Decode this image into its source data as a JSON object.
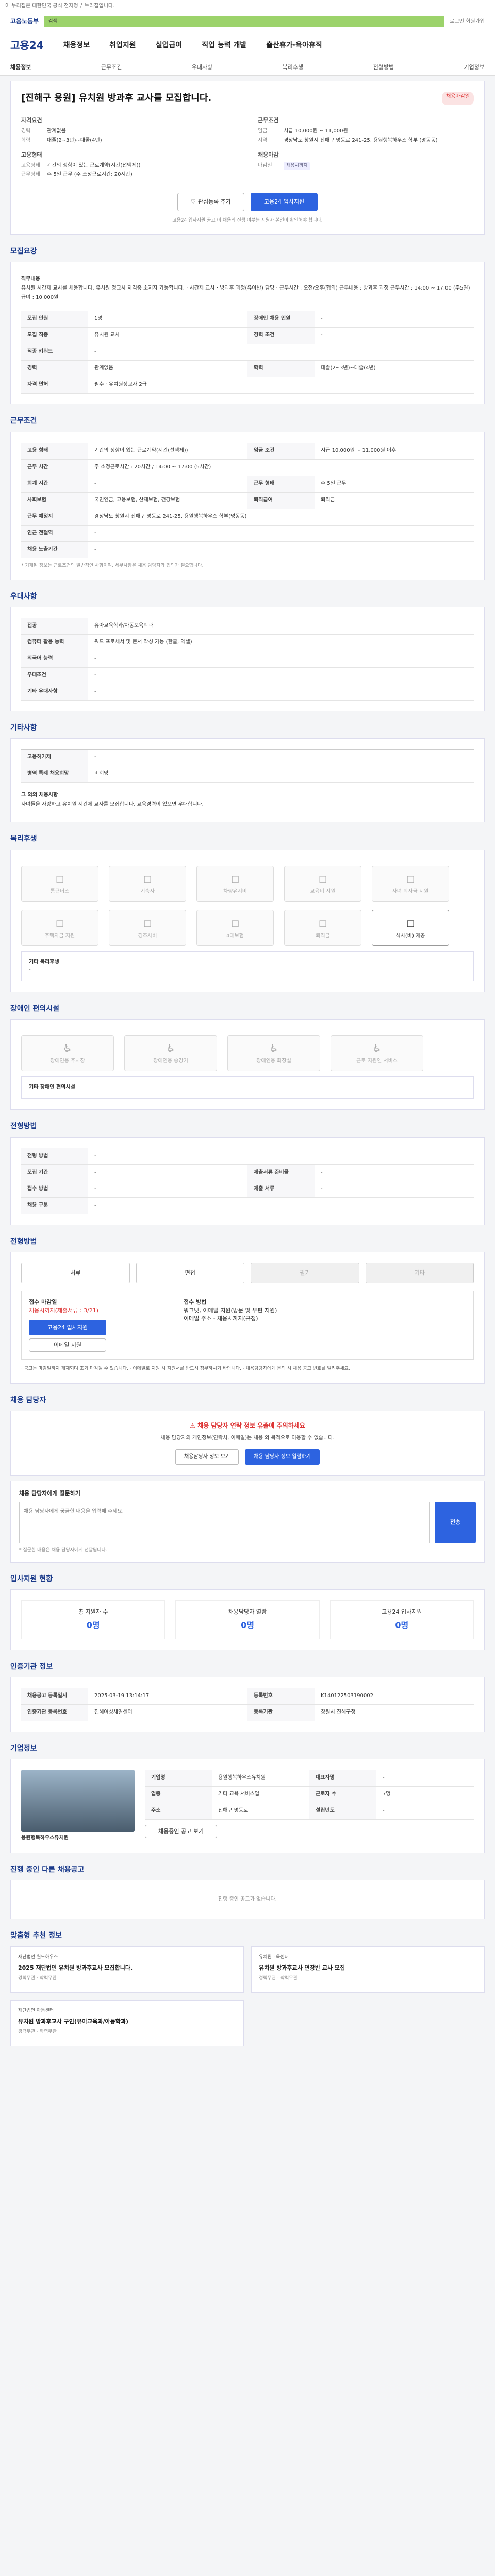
{
  "topnote": "이 누리집은 대한민국 공식 전자정부 누리집입니다.",
  "header": {
    "gov_logo": "고용노동부",
    "search_placeholder": "검색",
    "util": "로그인  회원가입",
    "brand": "고용24",
    "menu": [
      "채용정보",
      "취업지원",
      "실업급여",
      "직업 능력 개발",
      "출산휴가·육아휴직"
    ],
    "crumb_left": "채용정보",
    "crumb_tabs": [
      "근무조건",
      "우대사항",
      "복리후생",
      "전형방법",
      "기업정보"
    ]
  },
  "summary": {
    "title": "[진해구 용원] 유치원 방과후 교사를 모집합니다.",
    "badge": "채용마감일",
    "job_h": "자격요건",
    "job": [
      {
        "k": "경력",
        "v": "관계없음"
      },
      {
        "k": "학력",
        "v": "대졸(2~3년)~대졸(4년)"
      }
    ],
    "cond_h": "근무조건",
    "cond": [
      {
        "k": "임금",
        "v": "시급 10,000원 ~ 11,000원"
      },
      {
        "k": "지역",
        "v": "경상남도 창원시 진해구 명동로 241-25, 용원행복하우스 학부 (명동동)"
      }
    ],
    "form_h": "고용형태",
    "form": [
      {
        "k": "고용형태",
        "v": "기간의 정함이 있는 근로계약(시간(선택제))"
      },
      {
        "k": "근무형태",
        "v": "주 5일 근무 (주 소정근로시간: 20시간)"
      }
    ],
    "apply_h": "채용마감",
    "apply": [
      {
        "k": "마감일",
        "v": "채용시까지"
      }
    ],
    "btn_scrap": "관심등록 추가",
    "btn_apply": "고용24 입사지원",
    "note": "고용24 입사지원 공고 이 채용의 진행 여부는 지원자 본인이 확인해야 합니다."
  },
  "req": {
    "title": "모집요강",
    "role_h": "직무내용",
    "role": "유치원 시간제 교사를 채용합니다. 유치원 정교사 자격증 소지자 가능합니다. · 시간제 교사 · 방과후 과정(유아반) 담당 · 근무시간 : 오전/오후(협의) 근무내용 : 방과후 과정 근무시간 : 14:00 ~ 17:00 (주5일) 급여 : 10,000원",
    "rows": [
      {
        "k": "모집 인원",
        "v": "1명",
        "k2": "장애인 채용 인원",
        "v2": "-"
      },
      {
        "k": "모집 직종",
        "v": "유치원 교사",
        "k2": "경력 조건",
        "v2": "-"
      },
      {
        "k": "직종 키워드",
        "v": "-",
        "k2": "",
        "v2": ""
      },
      {
        "k": "경력",
        "v": "관계없음",
        "k2": "학력",
        "v2": "대졸(2~3년)~대졸(4년)"
      },
      {
        "k": "자격 면허",
        "v": "필수 · 유치원정교사 2급",
        "k2": "",
        "v2": ""
      }
    ]
  },
  "work": {
    "title": "근무조건",
    "rows": [
      {
        "k": "고용 형태",
        "v": "기간의 정함이 있는 근로계약(시간(선택제))",
        "k2": "임금 조건",
        "v2": "시급 10,000원 ~ 11,000원 이후"
      },
      {
        "k": "근무 시간",
        "v": "주 소정근로시간 : 20시간 / 14:00 ~ 17:00 (5시간)",
        "k2": "",
        "v2": ""
      },
      {
        "k": "회계 시간",
        "v": "-",
        "k2": "근무 형태",
        "v2": "주 5일 근무"
      },
      {
        "k": "사회보험",
        "v": "국민연금, 고용보험, 산재보험, 건강보험",
        "k2": "퇴직급여",
        "v2": "퇴직금"
      },
      {
        "k": "근무 예정지",
        "v": "경상남도 창원시 진해구 명동로 241-25, 용원행복하우스 학부(명동동)",
        "k2": "",
        "v2": ""
      },
      {
        "k": "인근 전철역",
        "v": "-",
        "k2": "",
        "v2": ""
      },
      {
        "k": "채용 노출기간",
        "v": "-",
        "k2": "",
        "v2": ""
      }
    ],
    "map_btn": "지도 보기",
    "hint": "* 기재된 정보는 근로조건의 일반적인 사항이며, 세부사항은 채용 담당자와 협의가 필요합니다."
  },
  "pref": {
    "title": "우대사항",
    "rows": [
      {
        "k": "전공",
        "v": "유아교육학과/아동보육학과"
      },
      {
        "k": "컴퓨터 활용 능력",
        "v": "워드 프로세서 및 문서 작성 가능 (한글, 엑셀)"
      },
      {
        "k": "외국어 능력",
        "v": "-"
      },
      {
        "k": "우대조건",
        "v": "-"
      },
      {
        "k": "기타 우대사항",
        "v": "-"
      }
    ]
  },
  "etc": {
    "title": "기타사항",
    "rows": [
      {
        "k": "고용허가제",
        "v": "-"
      },
      {
        "k": "병역 특례 채용희망",
        "v": "비희망"
      }
    ],
    "detail_h": "그 외의 채용사항",
    "detail": "자녀들을 사랑하고 유치원 시간제 교사를 모집합니다. 교육경력이 있으면 우대합니다."
  },
  "welfare": {
    "title": "복리후생",
    "items": [
      "통근버스",
      "기숙사",
      "차량유지비",
      "교육비 지원",
      "자녀 학자금 지원",
      "주택자금 지원",
      "경조사비",
      "4대보험",
      "퇴직금",
      "식사(비) 제공"
    ],
    "active": [
      9
    ],
    "other_h": "기타 복리후생",
    "other": "-"
  },
  "disab": {
    "title": "장애인 편의시설",
    "items": [
      "장애인용 주차장",
      "장애인용 승강기",
      "장애인용 화장실",
      "근로 지원인 서비스"
    ],
    "other": "기타 장애인 편의시설"
  },
  "sel": {
    "title": "전형방법",
    "rows": [
      {
        "k": "전형 방법",
        "v": "-"
      },
      {
        "k": "모집 기간",
        "v": "-",
        "k2": "제출서류 준비물",
        "v2": "-"
      },
      {
        "k": "접수 방법",
        "v": "-",
        "k2": "제출 서류",
        "v2": "-"
      },
      {
        "k": "채용 구분",
        "v": "-",
        "k2": "",
        "v2": ""
      }
    ]
  },
  "howto": {
    "title": "전형방법",
    "tabs": [
      "서류",
      "면접",
      "필기",
      "기타"
    ],
    "left_h": "접수 마감일",
    "left_red": "채용시까지(제출서류 : 3/21)",
    "apply_btn": "고용24 입사지원",
    "extra_btn": "이메일 지원",
    "right_h": "접수 방법",
    "right": "워크넷, 이메일 지원(방문 및 우편 지원)",
    "right2": "이메일 주소 - 채용시까지(규정)",
    "warn": "· 공고는 마감일까지 게재되며 조기 마감될 수 있습니다. · 이메일로 지원 시 지원서를 반드시 첨부하시기 바랍니다. · 채용담당자에게 문의 시 채용 공고 번호를 알려주세요."
  },
  "contact": {
    "title": "채용 담당자",
    "alert_t": "채용 담당자 연락 정보 유출에 주의하세요",
    "alert_p": "채용 담당자의 개인정보(연락처, 이메일)는 채용 외 목적으로 이용할 수 없습니다.",
    "btn1": "채용담당자 정보 보기",
    "btn2": "채용 담당자 정보 열람하기",
    "q_h": "채용 담당자에게 질문하기",
    "q_ph": "채용 담당자에게 궁금한 내용을 입력해 주세요.",
    "q_btn": "전송",
    "q_note": "* 질문한 내용은 채용 담당자에게 전달됩니다."
  },
  "stats": {
    "title": "입사지원 현황",
    "items": [
      {
        "k": "총 지원자 수",
        "v": "0명"
      },
      {
        "k": "채용담당자 열람",
        "v": "0명"
      },
      {
        "k": "고용24 입사지원",
        "v": "0명"
      }
    ]
  },
  "reginfo": {
    "title": "인증기관 정보",
    "rows": [
      {
        "k": "채용공고 등록일시",
        "v": "2025-03-19 13:14:17",
        "k2": "등록번호",
        "v2": "K140122503190002"
      },
      {
        "k": "인증기관 등록번호",
        "v": "진해여성새일센터",
        "k2": "등록기관",
        "v2": "창원시 진해구청"
      }
    ]
  },
  "company": {
    "title": "기업정보",
    "name": "용원행복하우스유치원",
    "rows": [
      {
        "k": "기업명",
        "v": "용원행복하우스유치원",
        "k2": "대표자명",
        "v2": "-"
      },
      {
        "k": "업종",
        "v": "기타 교육 서비스업",
        "k2": "근로자 수",
        "v2": "7명"
      },
      {
        "k": "주소",
        "v": "진해구 명동로",
        "k2": "설립년도",
        "v2": "-"
      }
    ],
    "btn": "채용중인 공고 보기"
  },
  "other_jobs": {
    "title": "진행 중인 다른 채용공고",
    "empty": "진행 중인 공고가 없습니다."
  },
  "reco": {
    "title": "맞춤형 추천 정보",
    "items": [
      {
        "co": "재단법인 월드하우스",
        "tt": "2025 재단법인 유치원 방과후교사 모집합니다.",
        "meta": "경력무관  ·  학력무관"
      },
      {
        "co": "유치원교육센터",
        "tt": "유치원 방과후교사 연장반 교사 모집",
        "meta": "경력무관  ·  학력무관"
      },
      {
        "co": "재단법인 아동센터",
        "tt": "유치원 방과후교사 구인(유아교육과/아동학과)",
        "meta": "경력무관  ·  학력무관"
      }
    ]
  }
}
